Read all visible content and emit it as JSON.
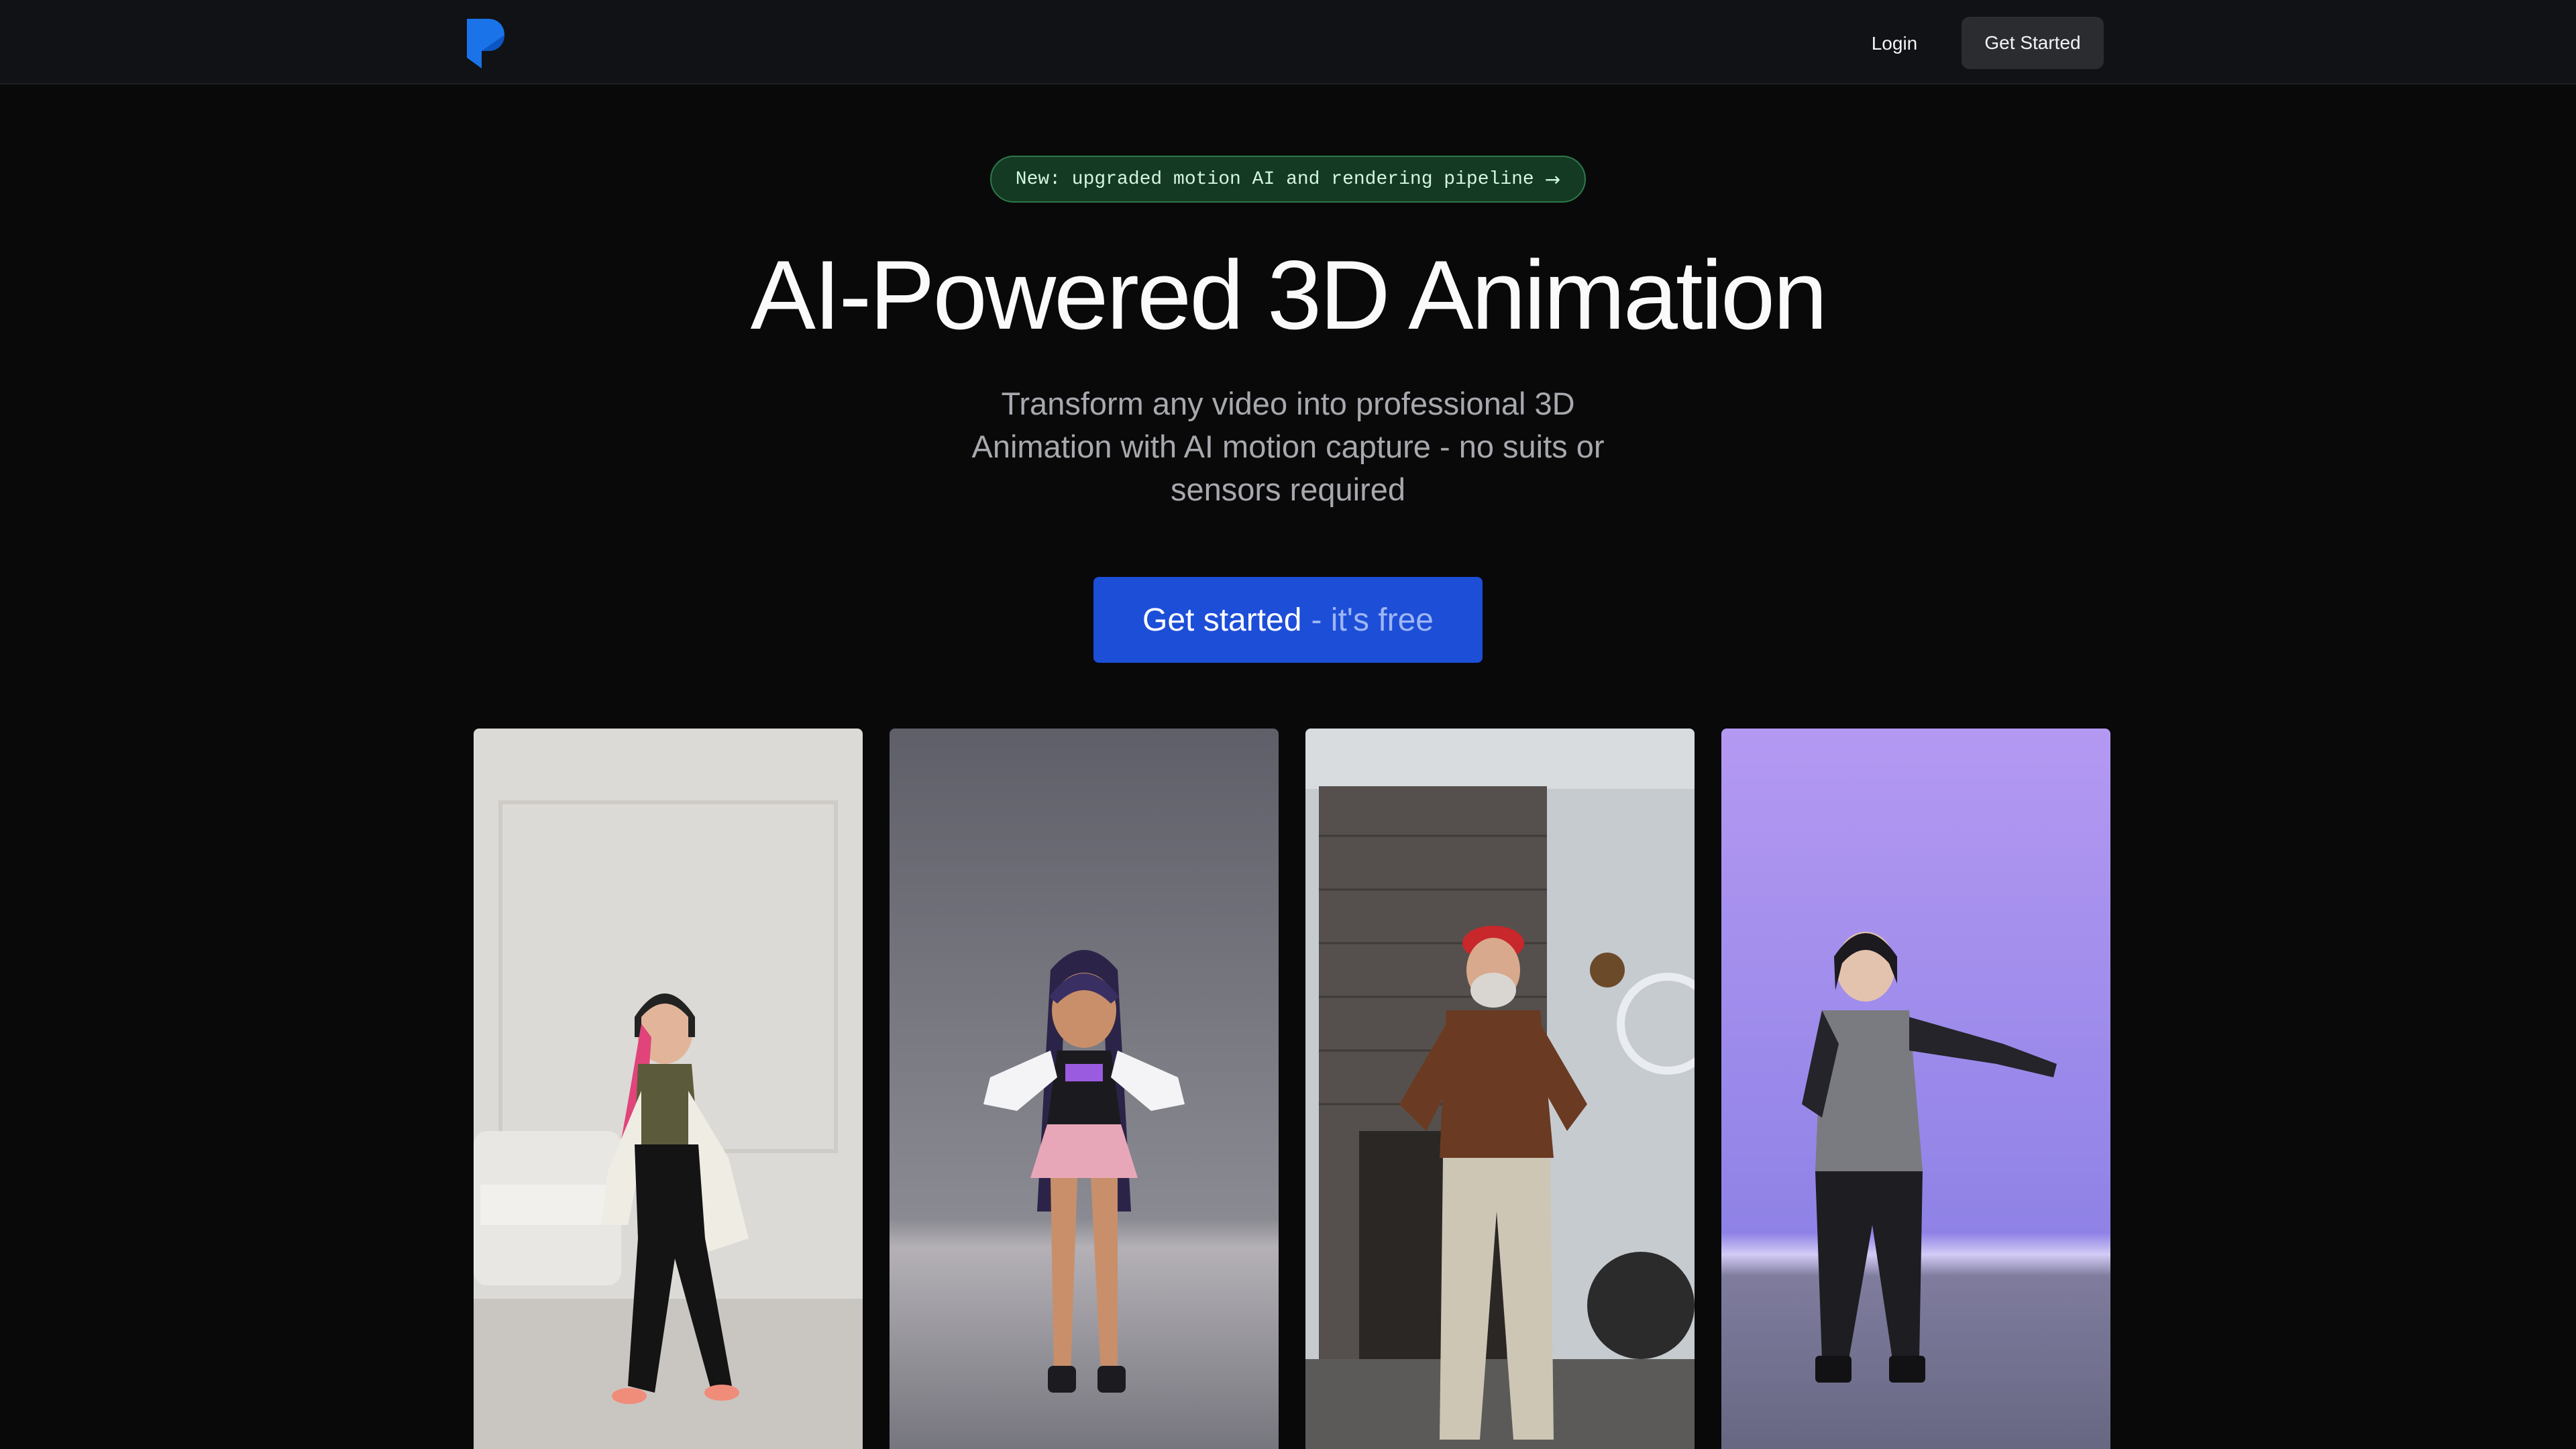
{
  "nav": {
    "login_label": "Login",
    "cta_label": "Get Started"
  },
  "announcement": {
    "text": "New: upgraded motion AI and rendering pipeline",
    "icon": "arrow-right-icon"
  },
  "hero": {
    "title": "AI-Powered 3D Animation",
    "subtitle": "Transform any video into professional 3D Animation with AI motion capture - no suits or sensors required",
    "cta_main": "Get started",
    "cta_sub": "- it's free"
  },
  "showcase": {
    "cards": [
      {
        "kind": "live-video",
        "background": "#d8d6d2"
      },
      {
        "kind": "3d-render",
        "background": "#6f7079"
      },
      {
        "kind": "live-video",
        "background": "#c7ccd1"
      },
      {
        "kind": "3d-render",
        "background": "#a78bef"
      }
    ]
  },
  "colors": {
    "page_background": "#09090a",
    "topbar": "#111215",
    "primary": "#1d4ed8",
    "logo_blue": "#1a73e8",
    "badge_green": "#143a24"
  }
}
